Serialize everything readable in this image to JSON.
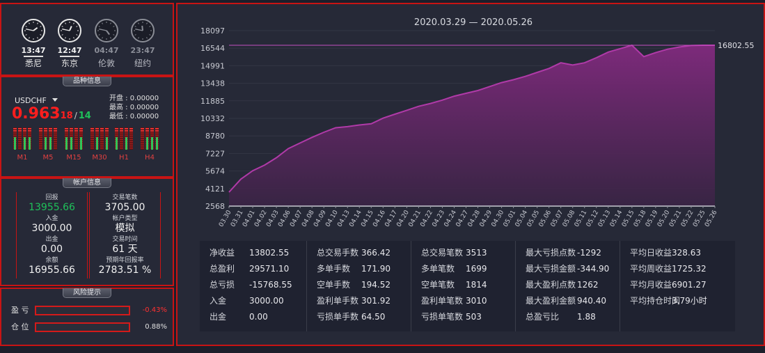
{
  "clocks": [
    {
      "time": "13:47",
      "city": "悉尼",
      "active": true,
      "h": 13,
      "m": 47
    },
    {
      "time": "12:47",
      "city": "东京",
      "active": true,
      "h": 12,
      "m": 47
    },
    {
      "time": "04:47",
      "city": "伦敦",
      "active": false,
      "h": 4,
      "m": 47
    },
    {
      "time": "23:47",
      "city": "纽约",
      "active": false,
      "h": 23,
      "m": 47
    }
  ],
  "symbol_panel": {
    "title": "品种信息",
    "symbol": "USDCHF",
    "price_main": "0.963",
    "price_bid": "18",
    "price_sep": "/",
    "price_ask": "14",
    "open_label": "开盘 : 0.00000",
    "high_label": "最高 : 0.00000",
    "low_label": "最低 : 0.00000",
    "timeframes": [
      "M1",
      "M5",
      "M15",
      "M30",
      "H1",
      "H4"
    ]
  },
  "account_panel": {
    "title": "帐户信息",
    "left": [
      {
        "key": "回报",
        "value": "13955.66",
        "color": "#1fc15a"
      },
      {
        "key": "入金",
        "value": "3000.00"
      },
      {
        "key": "出金",
        "value": "0.00"
      },
      {
        "key": "余额",
        "value": "16955.66"
      }
    ],
    "right": [
      {
        "key": "交易笔数",
        "value": "3705.00"
      },
      {
        "key": "帐户类型",
        "value": "模拟"
      },
      {
        "key": "交易时间",
        "value": "61 天"
      },
      {
        "key": "预期年回报率",
        "value": "2783.51 %"
      }
    ]
  },
  "risk_panel": {
    "title": "风险提示",
    "rows": [
      {
        "key": "盈  亏",
        "value": "-0.43%",
        "color": "#ff3030"
      },
      {
        "key": "仓  位",
        "value": "0.88%",
        "color": "#e0e0e0"
      }
    ]
  },
  "chart_data": {
    "type": "area",
    "title": "2020.03.29 — 2020.05.26",
    "xlabel": "",
    "ylabel": "",
    "ylim": [
      2568,
      18097
    ],
    "yticks": [
      "18097",
      "16544",
      "14991",
      "13438",
      "11885",
      "10332",
      "8780",
      "7227",
      "5674",
      "4121",
      "2568"
    ],
    "last_value_label": "16802.55",
    "reference_line": 16802.55,
    "grid": true,
    "line_color": "#b03aa8",
    "categories": [
      "03.30",
      "03.31",
      "04.01",
      "04.02",
      "04.03",
      "04.06",
      "04.07",
      "04.08",
      "04.09",
      "04.10",
      "04.13",
      "04.14",
      "04.15",
      "04.16",
      "04.17",
      "04.20",
      "04.21",
      "04.22",
      "04.23",
      "04.24",
      "04.27",
      "04.28",
      "04.29",
      "04.30",
      "05.01",
      "05.04",
      "05.05",
      "05.06",
      "05.07",
      "05.08",
      "05.11",
      "05.12",
      "05.13",
      "05.14",
      "05.15",
      "05.18",
      "05.19",
      "05.20",
      "05.21",
      "05.22",
      "05.25",
      "05.26"
    ],
    "values": [
      3800,
      4950,
      5700,
      6200,
      6850,
      7650,
      8150,
      8650,
      9100,
      9500,
      9600,
      9750,
      9850,
      10350,
      10700,
      11050,
      11400,
      11650,
      11950,
      12300,
      12550,
      12800,
      13150,
      13500,
      13750,
      14050,
      14400,
      14750,
      15250,
      15050,
      15250,
      15700,
      16200,
      16500,
      16800,
      15800,
      16150,
      16450,
      16650,
      16780,
      16802,
      16802
    ]
  },
  "stats": {
    "columns": [
      [
        {
          "k": "净收益",
          "v": "13802.55"
        },
        {
          "k": "总盈利",
          "v": "29571.10"
        },
        {
          "k": "总亏损",
          "v": "-15768.55"
        },
        {
          "k": "入金",
          "v": "3000.00"
        },
        {
          "k": "出金",
          "v": "0.00"
        }
      ],
      [
        {
          "k": "总交易手数",
          "v": "366.42"
        },
        {
          "k": "多单手数",
          "v": "171.90"
        },
        {
          "k": "空单手数",
          "v": "194.52"
        },
        {
          "k": "盈利单手数",
          "v": "301.92"
        },
        {
          "k": "亏损单手数",
          "v": "64.50"
        }
      ],
      [
        {
          "k": "总交易笔数",
          "v": "3513"
        },
        {
          "k": "多单笔数",
          "v": "1699"
        },
        {
          "k": "空单笔数",
          "v": "1814"
        },
        {
          "k": "盈利单笔数",
          "v": "3010"
        },
        {
          "k": "亏损单笔数",
          "v": "503"
        }
      ],
      [
        {
          "k": "最大亏损点数",
          "v": "-1292"
        },
        {
          "k": "最大亏损金额",
          "v": "-344.90"
        },
        {
          "k": "最大盈利点数",
          "v": "1262"
        },
        {
          "k": "最大盈利金额",
          "v": "940.40"
        },
        {
          "k": "总盈亏比",
          "v": "1.88"
        }
      ],
      [
        {
          "k": "平均日收益",
          "v": "328.63"
        },
        {
          "k": "平均周收益",
          "v": "1725.32"
        },
        {
          "k": "平均月收益",
          "v": "6901.27"
        },
        {
          "k": "平均持仓时间",
          "v": "3.79小时"
        }
      ]
    ]
  }
}
